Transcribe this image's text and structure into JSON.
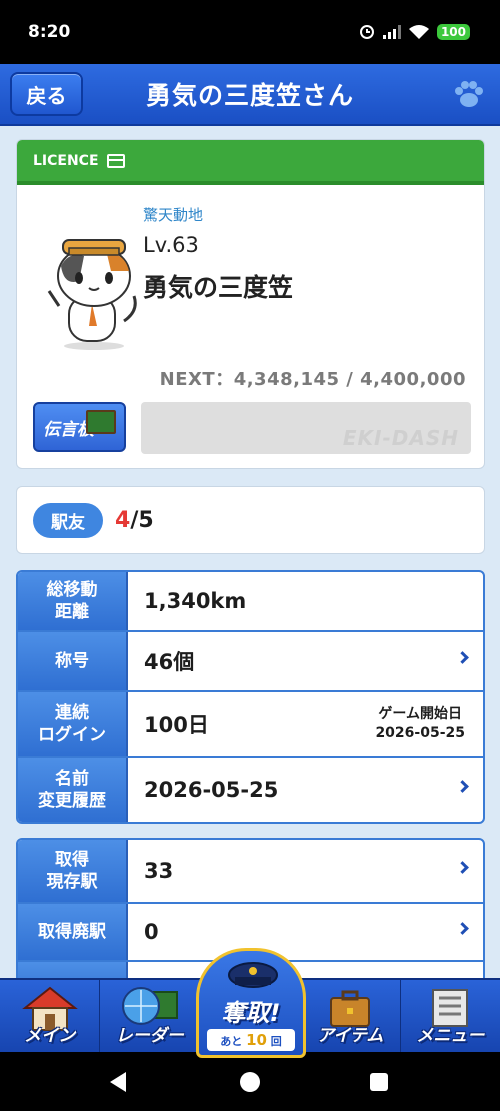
{
  "status": {
    "time": "8:20",
    "battery": "100"
  },
  "header": {
    "back_label": "戻る",
    "title": "勇気の三度笠さん"
  },
  "licence": {
    "header_label": "LICENCE",
    "epithet": "驚天動地",
    "level": "Lv.63",
    "name": "勇気の三度笠",
    "next": "NEXT：4,348,145 / 4,400,000",
    "board_button": "伝言板",
    "watermark": "EKI-DASH"
  },
  "friends": {
    "badge": "駅友",
    "current": "4",
    "total": "/5"
  },
  "stats": [
    {
      "label": "総移動\n距離",
      "value": "1,340km",
      "chevron": false
    },
    {
      "label": "称号",
      "value": "46個",
      "chevron": true
    },
    {
      "label": "連続\nログイン",
      "value": "100日",
      "note_title": "ゲーム開始日",
      "note_value": "2026-05-25",
      "chevron": false
    },
    {
      "label": "名前\n変更履歴",
      "value": "2026-05-25",
      "chevron": true
    }
  ],
  "stations": [
    {
      "label": "取得\n現存駅",
      "value": "33",
      "chevron": true
    },
    {
      "label": "取得廃駅",
      "value": "0",
      "chevron": true
    }
  ],
  "bottom_nav": {
    "main": "メイン",
    "radar": "レーダー",
    "center_main": "奪取!",
    "center_prefix": "あと",
    "center_count": "10",
    "center_suffix": "回",
    "item": "アイテム",
    "menu": "メニュー"
  }
}
